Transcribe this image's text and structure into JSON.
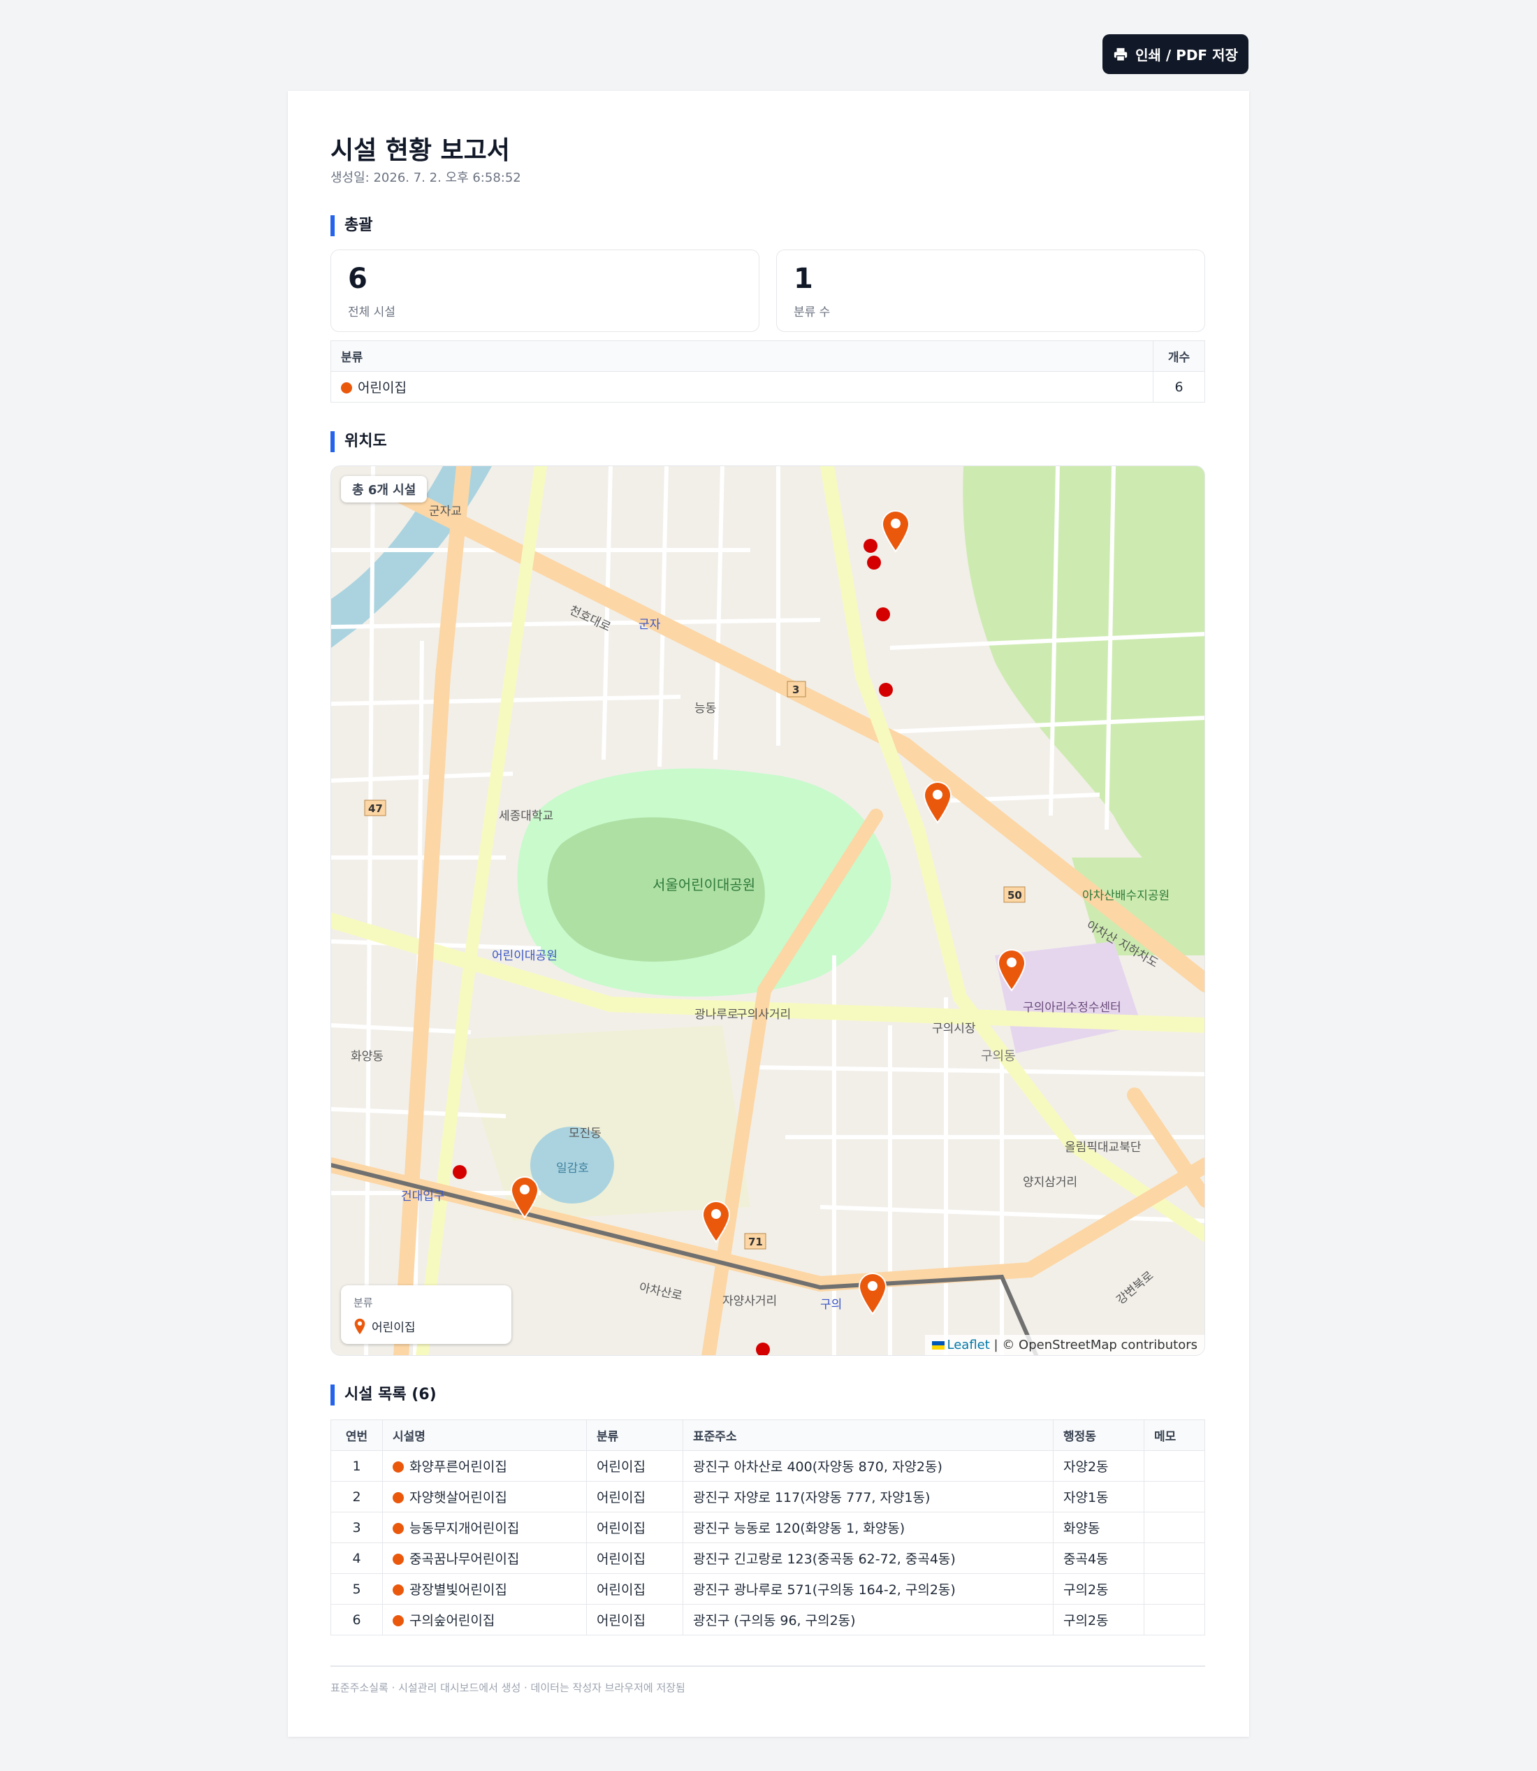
{
  "toolbar": {
    "print_label": "인쇄 / PDF 저장"
  },
  "report": {
    "title": "시설 현황 보고서",
    "generated": "생성일: 2026. 7. 2. 오후 6:58:52"
  },
  "summary": {
    "heading": "총괄",
    "cards": [
      {
        "value": "6",
        "label": "전체 시설"
      },
      {
        "value": "1",
        "label": "분류 수"
      }
    ],
    "table": {
      "headers": [
        "분류",
        "개수"
      ],
      "rows": [
        {
          "category": "어린이집",
          "count": "6"
        }
      ]
    }
  },
  "map_section": {
    "heading": "위치도",
    "badge": "총 6개 시설",
    "legend_title": "분류",
    "legend_item": "어린이집",
    "attribution_link": "Leaflet",
    "attribution_text": "| © OpenStreetMap contributors",
    "labels": {
      "gunjagyo": "군자교",
      "cheonhodaero": "천호대로",
      "gunja": "군자",
      "neungdong": "능동",
      "sejong": "세종대학교",
      "childpark": "서울어린이대공원",
      "childpark_station": "어린이대공원",
      "gwangnaru": "광나루로",
      "hwayang": "화양동",
      "mojin": "모진동",
      "ilgamho": "일감호",
      "konkuk": "건대입구",
      "achasan": "아차산로",
      "guui": "구의",
      "guui_station": "구의역",
      "guui_sageori": "구의사거리",
      "guui_market": "구의시장",
      "guuidong": "구의동",
      "jayang_sageori": "자양사거리",
      "yangji": "양지삼거리",
      "olympic": "올림픽대교북단",
      "gangbyeon": "강변북로",
      "achasan_tunnel": "아차산 지하차도",
      "achasan_park": "아차산배수지공원",
      "guui_arisu": "구의아리수정수센터",
      "road_3": "3",
      "road_47": "47",
      "road_50": "50",
      "road_71": "71"
    }
  },
  "facilities": {
    "heading": "시설 목록 (6)",
    "headers": [
      "연번",
      "시설명",
      "분류",
      "표준주소",
      "행정동",
      "메모"
    ],
    "rows": [
      {
        "no": "1",
        "name": "화양푸른어린이집",
        "category": "어린이집",
        "address": "광진구 아차산로 400(자양동 870, 자양2동)",
        "dong": "자양2동",
        "memo": ""
      },
      {
        "no": "2",
        "name": "자양햇살어린이집",
        "category": "어린이집",
        "address": "광진구 자양로 117(자양동 777, 자양1동)",
        "dong": "자양1동",
        "memo": ""
      },
      {
        "no": "3",
        "name": "능동무지개어린이집",
        "category": "어린이집",
        "address": "광진구 능동로 120(화양동 1, 화양동)",
        "dong": "화양동",
        "memo": ""
      },
      {
        "no": "4",
        "name": "중곡꿈나무어린이집",
        "category": "어린이집",
        "address": "광진구 긴고랑로 123(중곡동 62-72, 중곡4동)",
        "dong": "중곡4동",
        "memo": ""
      },
      {
        "no": "5",
        "name": "광장별빛어린이집",
        "category": "어린이집",
        "address": "광진구 광나루로 571(구의동 164-2, 구의2동)",
        "dong": "구의2동",
        "memo": ""
      },
      {
        "no": "6",
        "name": "구의숲어린이집",
        "category": "어린이집",
        "address": "광진구 (구의동 96, 구의2동)",
        "dong": "구의2동",
        "memo": ""
      }
    ]
  },
  "footer": "표준주소실록 · 시설관리 대시보드에서 생성 · 데이터는 작성자 브라우저에 저장됨",
  "colors": {
    "accent": "#2563eb",
    "marker": "#ea580c",
    "dark_button": "#111827"
  }
}
